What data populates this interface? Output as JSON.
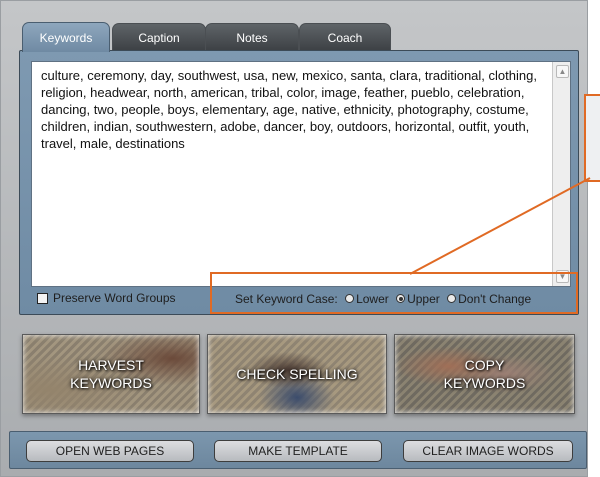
{
  "tabs": [
    {
      "label": "Keywords",
      "active": true
    },
    {
      "label": "Caption",
      "active": false
    },
    {
      "label": "Notes",
      "active": false
    },
    {
      "label": "Coach",
      "active": false
    }
  ],
  "keywords_text": "culture, ceremony, day, southwest, usa, new, mexico, santa, clara, traditional, clothing, religion, headwear, north, american, tribal, color, image, feather, pueblo, celebration, dancing, two, people, boys, elementary, age, native, ethnicity, photography, costume, children, indian, southwestern, adobe, dancer, boy, outdoors, horizontal, outfit, youth, travel, male, destinations",
  "options": {
    "preserve_label": "Preserve Word Groups",
    "preserve_checked": false,
    "case_label": "Set Keyword Case:",
    "case_options": [
      "Lower",
      "Upper",
      "Don't Change"
    ],
    "case_selected": "Upper"
  },
  "image_buttons": {
    "harvest": "HARVEST KEYWORDS",
    "spell": "CHECK SPELLING",
    "copy": "COPY KEYWORDS"
  },
  "bottom_buttons": {
    "open_web": "OPEN WEB PAGES",
    "template": "MAKE TEMPLATE",
    "clear": "CLEAR IMAGE WORDS"
  },
  "colors": {
    "accent_callout": "#e06a24",
    "panel_blue": "#7e99b1",
    "tab_active": "#8ea7bd",
    "tab_inactive": "#4c5055"
  }
}
